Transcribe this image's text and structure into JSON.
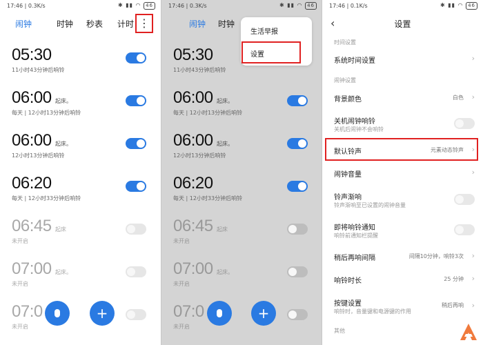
{
  "colors": {
    "accent": "#2a7ae2",
    "highlight": "#e02020",
    "dim_background": "#d4d4d4",
    "logo": "#f07a3c"
  },
  "status": {
    "left": {
      "time": "17:46",
      "speed": "0.3K/s"
    },
    "mid": {
      "time": "17:46",
      "speed": "0.3K/s"
    },
    "right": {
      "time": "17:46",
      "speed": "0.1K/s"
    },
    "battery": "46"
  },
  "tabs": [
    "闹钟",
    "时钟",
    "秒表",
    "计时"
  ],
  "more_icon": "⋮",
  "alarms": [
    {
      "time": "05:30",
      "note": "",
      "sub": "11小时43分钟后响铃",
      "enabled": true
    },
    {
      "time": "06:00",
      "note": "起床。",
      "sub": "每天 | 12小时13分钟后响铃",
      "enabled": true
    },
    {
      "time": "06:00",
      "note": "起床。",
      "sub": "12小时13分钟后响铃",
      "enabled": true
    },
    {
      "time": "06:20",
      "note": "",
      "sub": "每天 | 12小时33分钟后响铃",
      "enabled": true
    },
    {
      "time": "06:45",
      "note": "起床",
      "sub": "未开启",
      "enabled": false
    },
    {
      "time": "07:00",
      "note": "起床。",
      "sub": "未开启",
      "enabled": false
    },
    {
      "time": "07:0",
      "note": "",
      "sub": "未开启",
      "enabled": false
    }
  ],
  "menu": [
    "生活早报",
    "设置"
  ],
  "fab": {
    "voice_icon": "mic-icon",
    "add_label": "+"
  },
  "settings": {
    "back_icon": "‹",
    "title": "设置",
    "section_time": "时间设置",
    "system_time": "系统时间设置",
    "section_alarm": "闹钟设置",
    "bg_color": "背景颜色",
    "bg_color_value": "白色",
    "power_off_alarm": "关机闹钟响铃",
    "power_off_alarm_sub": "关机后闹钟不会响铃",
    "default_ringtone": "默认铃声",
    "default_ringtone_value": "元素动态铃声",
    "alarm_volume": "闹钟音量",
    "fade_in": "铃声渐响",
    "fade_in_sub": "铃声渐响至已设置的闹钟音量",
    "upcoming_notice": "即将响铃通知",
    "upcoming_notice_sub": "响铃前通知栏提醒",
    "snooze": "稍后再响间隔",
    "snooze_value": "间隔10分钟，响铃3次",
    "ring_duration": "响铃时长",
    "ring_duration_value": "25 分钟",
    "button_settings": "按键设置",
    "button_settings_sub": "响铃时，音量键和电源键的作用",
    "button_settings_value": "稍后再响",
    "section_other": "其他"
  }
}
